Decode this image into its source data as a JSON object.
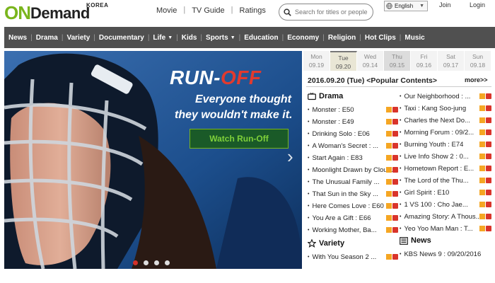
{
  "header": {
    "logo_on": "ON",
    "logo_demand": "Demand",
    "logo_korea": "KOREA",
    "nav": [
      "Movie",
      "TV Guide",
      "Ratings"
    ],
    "search_placeholder": "Search for titles or people",
    "language": "English",
    "join": "Join",
    "login": "Login"
  },
  "categories": [
    {
      "label": "News"
    },
    {
      "label": "Drama"
    },
    {
      "label": "Variety"
    },
    {
      "label": "Documentary"
    },
    {
      "label": "Life",
      "dropdown": true
    },
    {
      "label": "Kids"
    },
    {
      "label": "Sports",
      "dropdown": true
    },
    {
      "label": "Education"
    },
    {
      "label": "Economy"
    },
    {
      "label": "Religion"
    },
    {
      "label": "Hot Clips"
    },
    {
      "label": "Music"
    }
  ],
  "hero": {
    "title_a": "RUN-",
    "title_b": "OFF",
    "subtitle_1": "Everyone thought",
    "subtitle_2": "they wouldn't make it.",
    "button": "Watch Run-Off",
    "slides": 4,
    "active_slide": 1
  },
  "panel": {
    "days": [
      {
        "dow": "Mon",
        "date": "09.19"
      },
      {
        "dow": "Tue",
        "date": "09.20",
        "today": true
      },
      {
        "dow": "Wed",
        "date": "09.14"
      },
      {
        "dow": "Thu",
        "date": "09.15"
      },
      {
        "dow": "Fri",
        "date": "09.16"
      },
      {
        "dow": "Sat",
        "date": "09.17"
      },
      {
        "dow": "Sun",
        "date": "09.18"
      }
    ],
    "heading": "2016.09.20 (Tue) <Popular Contents>",
    "more": "more>>",
    "drama_title": "Drama",
    "drama": [
      "Monster : E50",
      "Monster : E49",
      "Drinking Solo : E06",
      "A Woman's Secret : ...",
      "Start Again : E83",
      "Moonlight Drawn by Clou...",
      "The Unusual Family ...",
      "That Sun in the Sky ...",
      "Here Comes Love : E60",
      "You Are a Gift : E66",
      "Working Mother, Ba..."
    ],
    "variety_title": "Variety",
    "variety": [
      "With You Season 2 ..."
    ],
    "right": [
      "Our Neighborhood : ...",
      "Taxi : Kang Soo-jung",
      "Charles the Next Do...",
      "Morning Forum : 09/2...",
      "Burning Youth : E74",
      "Live Info Show 2 : 0...",
      "Hometown Report : E...",
      "The Lord of the Thu...",
      "Girl Spirit : E10",
      "1 VS 100 : Cho Jae...",
      "Amazing Story: A Thous...",
      "Yeo Yoo Man Man : T..."
    ],
    "news_title": "News",
    "news": [
      "KBS News 9 : 09/20/2016"
    ]
  }
}
